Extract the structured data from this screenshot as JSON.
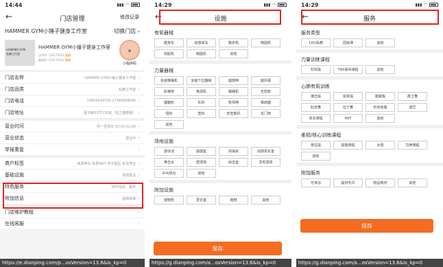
{
  "panel1": {
    "time": "14:44",
    "title": "门店管理",
    "right_action": "修改记录",
    "store_name": "HAMMER GYM小锤子健身工作室",
    "switch_label": "切换门店",
    "thumb_text": [
      "HAMMER GYM",
      "私教工作室"
    ],
    "card_title": "HAMMER GYM小锤子健身工作室",
    "card_sub1_prefix": "点评ID: 528170922",
    "card_sub2_prefix": "美团ID: 528170922",
    "copy_label": "复制",
    "qr_label": "小程序码",
    "rows": [
      {
        "label": "门店名称",
        "value": "HAMMER GYM小锤子健身工作室"
      },
      {
        "label": "门店品类",
        "value": "私教工作室"
      },
      {
        "label": "门店电话",
        "value": "19859544700,17369568640"
      },
      {
        "label": "门店地址",
        "value": "夏洪路33号130室（悦之邀额楼）"
      },
      {
        "label": "营业时间",
        "value": "周一至周日 10:00-22:00"
      },
      {
        "label": "营业状态",
        "value": "营业中"
      },
      {
        "label": "举报重复",
        "value": ""
      },
      {
        "label": "商户标签",
        "value": "免费停车  免费WIFI  有无烟区  有充电宝"
      },
      {
        "label": "基础设施",
        "value": "场地建设"
      },
      {
        "label": "特色服务",
        "value": "WIFI信息、服务"
      },
      {
        "label": "附加信息",
        "value": "品牌故事"
      },
      {
        "label": "门店维护教程",
        "value": ""
      },
      {
        "label": "在线客服",
        "value": ""
      }
    ],
    "url": "https://e.dianping.com/p...osVersion=13.6&is_kp=0"
  },
  "panel2": {
    "time": "14:29",
    "title": "设施",
    "save": "保存",
    "url": "https://g.dianping.com/a...osVersion=13.6&is_kp=0",
    "sections": [
      {
        "title": "有氧器械",
        "items": [
          "健身车",
          "动感单车",
          "跑步机",
          "椭圆机",
          "划船机",
          "椭圆机",
          "其他"
        ]
      },
      {
        "title": "力量器械",
        "items": [
          "坐姿推胸机",
          "坐姿下拉器械",
          "腿部伸",
          "腿外展",
          "卧推架",
          "奥源机",
          "蝴蝶机",
          "史密斯",
          "腱腹轮",
          "杠铃",
          "牧师椅",
          "推肩器",
          "哑铃",
          "壶铃",
          "史密斯机",
          "龙门架",
          "其他"
        ]
      },
      {
        "title": "场地设施",
        "items": [
          "游泳池",
          "瑜伽室",
          "体操房",
          "动感单车室",
          "拳击台",
          "壁球场",
          "射击室",
          "羽毛球场",
          "乒乓球台",
          "其他"
        ]
      },
      {
        "title": "附加设施",
        "items": [
          "储物柜",
          "更衣室",
          "拖鞋",
          "其他"
        ]
      }
    ]
  },
  "panel3": {
    "time": "14:29",
    "title": "服务",
    "save": "保存",
    "url": "https://g.dianping.com/a...osVersion=13.6&is_kp=0",
    "sections": [
      {
        "title": "服务类型",
        "items": [
          "1对1私教",
          "团操课",
          "其他"
        ]
      },
      {
        "title": "力量训练课程",
        "items": [
          "杠铃操",
          "TRX悬吊课程",
          "其他"
        ]
      },
      {
        "title": "心肺有氧训练",
        "items": [
          "搏击操",
          "有氧操",
          "踏跳板",
          "爵士舞",
          "肚皮舞",
          "拉丁舞",
          "形体芭蕾",
          "尊巴",
          "单车课程",
          "HIIT",
          "其他"
        ]
      },
      {
        "title": "柔韧/核心训练课程",
        "items": [
          "普拉提",
          "瑜伽课程",
          "太极",
          "拉伸课程",
          "其他"
        ]
      },
      {
        "title": "附加服务",
        "items": [
          "可淋浴",
          "提供毛巾",
          "物品寄存",
          "其他"
        ]
      }
    ]
  }
}
